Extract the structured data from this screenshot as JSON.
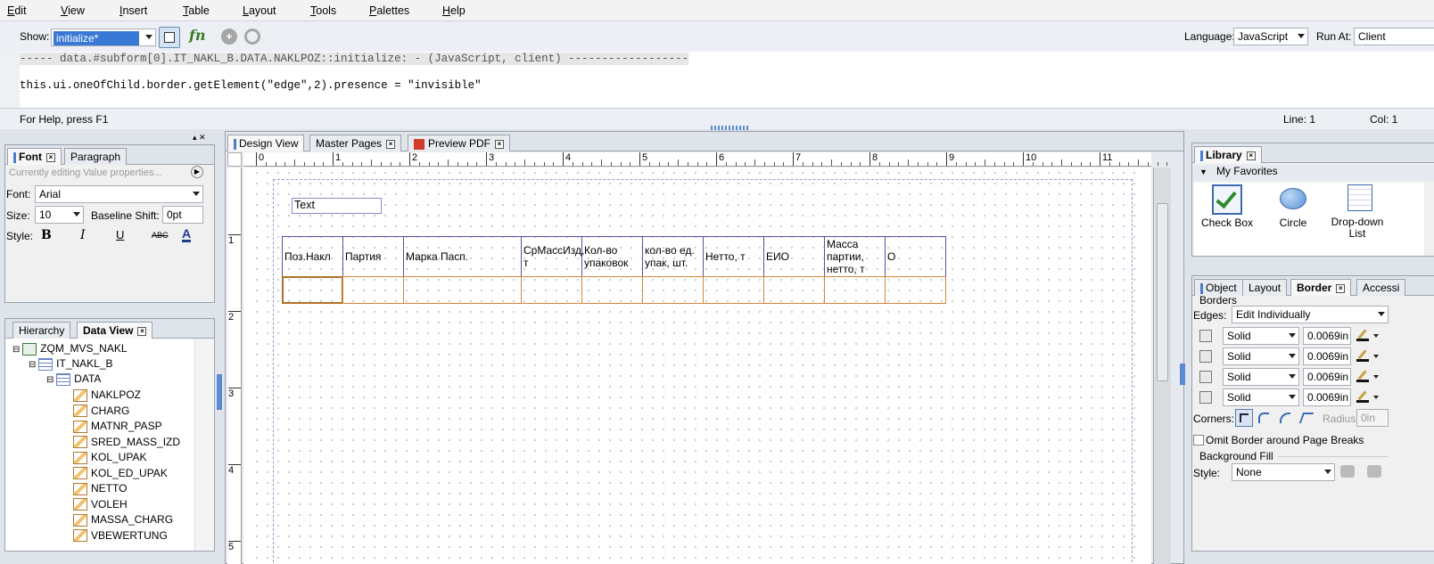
{
  "menu": [
    "Edit",
    "View",
    "Insert",
    "Table",
    "Layout",
    "Tools",
    "Palettes",
    "Help"
  ],
  "editor": {
    "show_label": "Show:",
    "show_value": "initialize*",
    "language_label": "Language:",
    "language_value": "JavaScript",
    "run_at_label": "Run At:",
    "run_at_value": "Client",
    "code_header": "----- data.#subform[0].IT_NAKL_B.DATA.NAKLPOZ::initialize: - (JavaScript, client) ------------------",
    "code_line": "this.ui.oneOfChild.border.getElement(\"edge\",2).presence = \"invisible\"",
    "status_help": "For Help, press F1",
    "status_line": "Line: 1",
    "status_col": "Col: 1"
  },
  "font_panel": {
    "tabs": [
      "Font",
      "Paragraph"
    ],
    "editing_note": "Currently editing Value properties...",
    "font_label": "Font:",
    "font_value": "Arial",
    "size_label": "Size:",
    "size_value": "10",
    "baseline_label": "Baseline Shift:",
    "baseline_value": "0pt",
    "style_label": "Style:",
    "style_buttons": [
      "B",
      "I",
      "U",
      "ABC",
      "A"
    ]
  },
  "data_panel": {
    "tabs": [
      "Hierarchy",
      "Data View"
    ],
    "root": "ZQM_MVS_NAKL",
    "group": "IT_NAKL_B",
    "sub": "DATA",
    "fields": [
      "NAKLPOZ",
      "CHARG",
      "MATNR_PASP",
      "SRED_MASS_IZD",
      "KOL_UPAK",
      "KOL_ED_UPAK",
      "NETTO",
      "VOLEH",
      "MASSA_CHARG",
      "VBEWERTUNG"
    ]
  },
  "design": {
    "tabs": [
      "Design View",
      "Master Pages",
      "Preview PDF"
    ],
    "ruler_marks": [
      "0",
      "1",
      "2",
      "3",
      "4",
      "5",
      "6",
      "7",
      "8",
      "9",
      "10",
      "11"
    ],
    "vruler_marks": [
      "1",
      "2",
      "3",
      "4",
      "5"
    ],
    "text_object": "Text",
    "headers": [
      "Поз.Накл",
      "Партия",
      "Марка Пасп.",
      "СрМассИзд, т",
      "Кол-во упаковок",
      "кол-во ед. упак, шт.",
      "Нетто, т",
      "ЕИО",
      "Масса партии, нетто, т",
      "О"
    ]
  },
  "library": {
    "title": "Library",
    "section": "My Favorites",
    "items": [
      "Check Box",
      "Circle",
      "Drop-down List"
    ]
  },
  "props": {
    "tabs": [
      "Object",
      "Layout",
      "Border",
      "Accessi"
    ],
    "borders_label": "Borders",
    "edges_label": "Edges:",
    "edges_value": "Edit Individually",
    "edge_rows": [
      {
        "style": "Solid",
        "width": "0.0069in"
      },
      {
        "style": "Solid",
        "width": "0.0069in"
      },
      {
        "style": "Solid",
        "width": "0.0069in"
      },
      {
        "style": "Solid",
        "width": "0.0069in"
      }
    ],
    "corners_label": "Corners:",
    "radius_label": "Radius:",
    "radius_value": "0in",
    "omit_label": "Omit Border around Page Breaks",
    "bgfill_label": "Background Fill",
    "style_label": "Style:",
    "style_value": "None"
  }
}
